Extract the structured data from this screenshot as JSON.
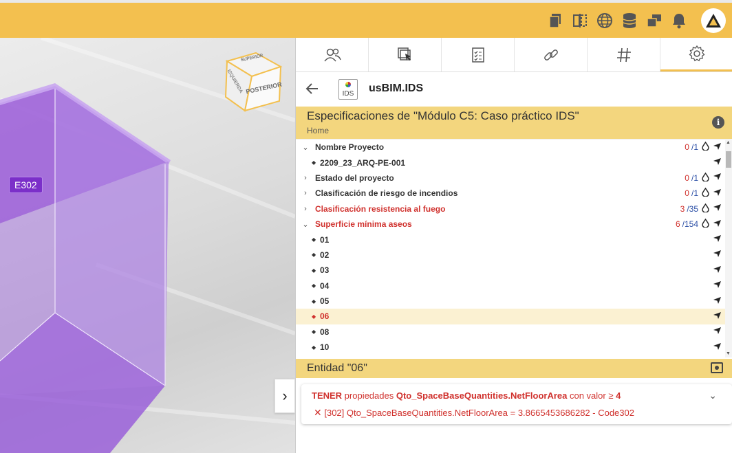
{
  "app": {
    "title": "usBIM.IDS",
    "logo_text": "IDS"
  },
  "viewer": {
    "space_label": "E302",
    "cube_faces": [
      "SUPERIOR",
      "POSTERIOR",
      "IZQUIERDA"
    ]
  },
  "tabs": [
    {
      "icon": "users-icon"
    },
    {
      "icon": "select-model-icon"
    },
    {
      "icon": "checklist-icon"
    },
    {
      "icon": "link-icon"
    },
    {
      "icon": "hash-icon"
    },
    {
      "icon": "settings-icon"
    }
  ],
  "spec": {
    "title": "Especificaciones de \"Módulo C5: Caso práctico IDS\"",
    "breadcrumb": "Home"
  },
  "tree": [
    {
      "type": "group",
      "label": "Nombre Proyecto",
      "expanded": true,
      "red": false,
      "count_a": "0",
      "count_b": "/1"
    },
    {
      "type": "leaf",
      "label": "2209_23_ARQ-PE-001"
    },
    {
      "type": "group",
      "label": "Estado del proyecto",
      "expanded": false,
      "red": false,
      "count_a": "0",
      "count_b": "/1"
    },
    {
      "type": "group",
      "label": "Clasificación de riesgo de incendios",
      "expanded": false,
      "red": false,
      "count_a": "0",
      "count_b": "/1"
    },
    {
      "type": "group",
      "label": "Clasificación resistencia al fuego",
      "expanded": false,
      "red": true,
      "count_a": "3",
      "count_b": "/35"
    },
    {
      "type": "group",
      "label": "Superficie mínima aseos",
      "expanded": true,
      "red": true,
      "count_a": "6",
      "count_b": "/154"
    },
    {
      "type": "leaf",
      "label": "01"
    },
    {
      "type": "leaf",
      "label": "02"
    },
    {
      "type": "leaf",
      "label": "03"
    },
    {
      "type": "leaf",
      "label": "04"
    },
    {
      "type": "leaf",
      "label": "05"
    },
    {
      "type": "leaf",
      "label": "06",
      "selected": true,
      "red": true
    },
    {
      "type": "leaf",
      "label": "08"
    },
    {
      "type": "leaf",
      "label": "10"
    }
  ],
  "entity": {
    "title": "Entidad \"06\"",
    "req_verb": "TENER",
    "req_text1": " propiedades ",
    "req_prop": "Qto_SpaceBaseQuantities.NetFloorArea",
    "req_text2": " con valor ≥ ",
    "req_value": "4",
    "error": "[302] Qto_SpaceBaseQuantities.NetFloorArea = 3.8665453686282 - Code302"
  },
  "colors": {
    "accent": "#f3c04f",
    "panel_header": "#f3d67e",
    "error": "#d0312d",
    "purple": "#7b2fc9"
  }
}
